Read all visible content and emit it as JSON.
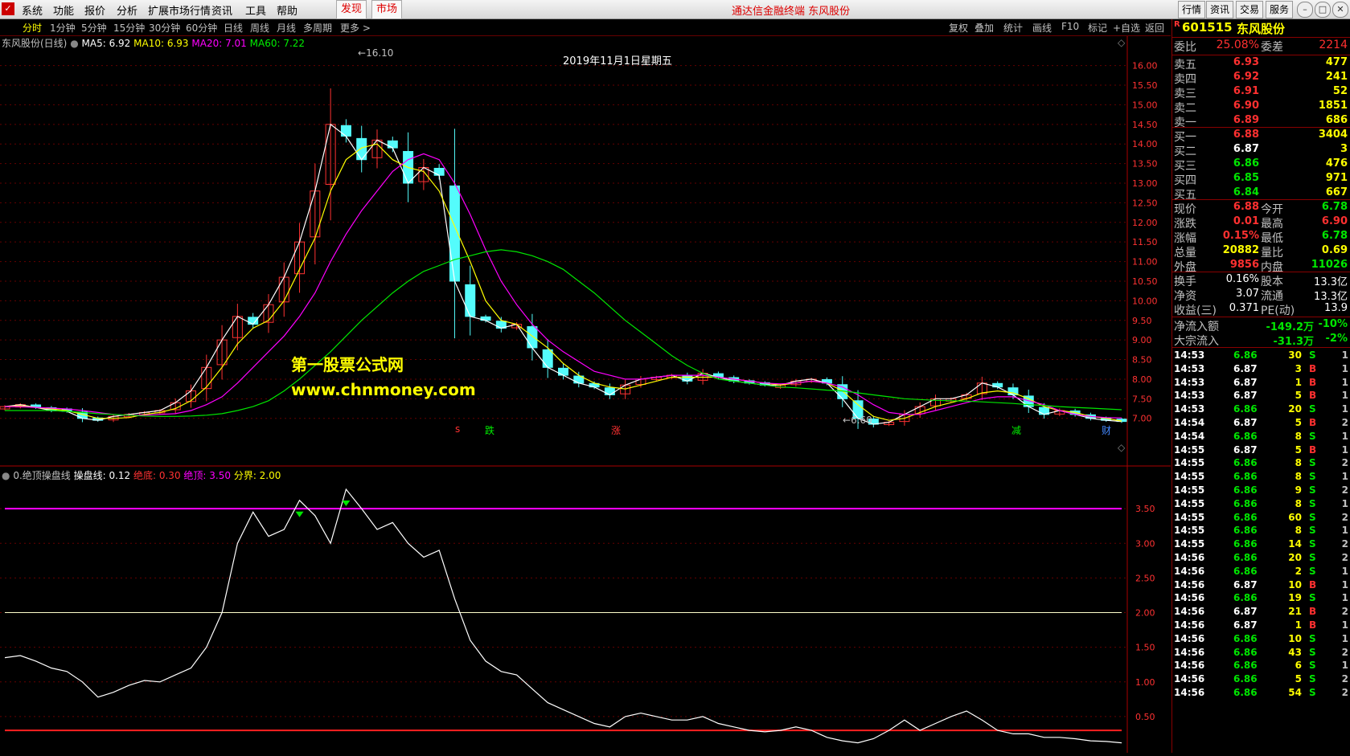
{
  "menu": {
    "items": [
      "系统",
      "功能",
      "报价",
      "分析",
      "扩展市场行情",
      "资讯",
      "工具",
      "帮助"
    ],
    "warn_btn": "发现",
    "market_btn": "市场",
    "app_title": "通达信金融终端  东风股份",
    "right_buttons": [
      "行情",
      "资讯",
      "交易",
      "服务"
    ]
  },
  "periods": [
    "分时",
    "1分钟",
    "5分钟",
    "15分钟",
    "30分钟",
    "60分钟",
    "日线",
    "周线",
    "月线",
    "多周期",
    "更多 >"
  ],
  "toolbar": [
    "复权",
    "叠加",
    "统计",
    "画线",
    "F10",
    "标记",
    "+自选",
    "返回"
  ],
  "main_legend": {
    "name": "东风股份(日线)",
    "ma5": "MA5: 6.92",
    "ma10": "MA10: 6.93",
    "ma20": "MA20: 7.01",
    "ma60": "MA60: 7.22"
  },
  "date_label": "2019年11月1日星期五",
  "high_label": "16.10",
  "low_label": "6.60",
  "watermark": {
    "line1": "第一股票公式网",
    "line2": "www.chnmoney.com"
  },
  "event_marks": [
    "s",
    "跌",
    "涨",
    "减",
    "财"
  ],
  "sub_legend": {
    "name": "0.绝顶操盘线",
    "line": "操盘线: 0.12",
    "bottom": "绝底: 0.30",
    "top": "绝顶: 3.50",
    "divide": "分界: 2.00"
  },
  "price_axis": [
    "16.00",
    "15.50",
    "15.00",
    "14.50",
    "14.00",
    "13.50",
    "13.00",
    "12.50",
    "12.00",
    "11.50",
    "11.00",
    "10.50",
    "10.00",
    "9.50",
    "9.00",
    "8.50",
    "8.00",
    "7.50",
    "7.00"
  ],
  "sub_axis": [
    "3.50",
    "3.00",
    "2.50",
    "2.00",
    "1.50",
    "1.00",
    "0.50"
  ],
  "colors": {
    "up": "#ff3232",
    "down": "#54fcfc",
    "ma5": "#ffffff",
    "ma10": "#ffff00",
    "ma20": "#ff00ff",
    "ma60": "#00e600"
  },
  "quote": {
    "code": "601515",
    "name": "东风股份",
    "weibi_label": "委比",
    "weibi": "25.08%",
    "weicha_label": "委差",
    "weicha": "2214",
    "asks": [
      {
        "label": "卖五",
        "price": "6.93",
        "vol": "477"
      },
      {
        "label": "卖四",
        "price": "6.92",
        "vol": "241"
      },
      {
        "label": "卖三",
        "price": "6.91",
        "vol": "52"
      },
      {
        "label": "卖二",
        "price": "6.90",
        "vol": "1851"
      },
      {
        "label": "卖一",
        "price": "6.89",
        "vol": "686"
      }
    ],
    "bids": [
      {
        "label": "买一",
        "price": "6.88",
        "vol": "3404"
      },
      {
        "label": "买二",
        "price": "6.87",
        "vol": "3"
      },
      {
        "label": "买三",
        "price": "6.86",
        "vol": "476"
      },
      {
        "label": "买四",
        "price": "6.85",
        "vol": "971"
      },
      {
        "label": "买五",
        "price": "6.84",
        "vol": "667"
      }
    ],
    "stats1": [
      {
        "l1": "现价",
        "v1": "6.88",
        "c1": "red",
        "l2": "今开",
        "v2": "6.78",
        "c2": "green"
      },
      {
        "l1": "涨跌",
        "v1": "0.01",
        "c1": "red",
        "l2": "最高",
        "v2": "6.90",
        "c2": "red"
      },
      {
        "l1": "涨幅",
        "v1": "0.15%",
        "c1": "red",
        "l2": "最低",
        "v2": "6.78",
        "c2": "green"
      },
      {
        "l1": "总量",
        "v1": "20882",
        "c1": "yellow",
        "l2": "量比",
        "v2": "0.69",
        "c2": "yellow"
      },
      {
        "l1": "外盘",
        "v1": "9856",
        "c1": "red",
        "l2": "内盘",
        "v2": "11026",
        "c2": "green"
      }
    ],
    "stats2": [
      {
        "l1": "换手",
        "v1": "0.16%",
        "l2": "股本",
        "v2": "13.3亿"
      },
      {
        "l1": "净资",
        "v1": "3.07",
        "l2": "流通",
        "v2": "13.3亿"
      },
      {
        "l1": "收益(三)",
        "v1": "0.371",
        "l2": "PE(动)",
        "v2": "13.9"
      }
    ],
    "flow": [
      {
        "label": "净流入额",
        "value": "-149.2万",
        "pct": "-10%"
      },
      {
        "label": "大宗流入",
        "value": "-31.3万",
        "pct": "-2%"
      }
    ]
  },
  "ticks": [
    {
      "t": "14:53",
      "p": "6.86",
      "v": "30",
      "s": "S",
      "n": "1"
    },
    {
      "t": "14:53",
      "p": "6.87",
      "v": "3",
      "s": "B",
      "n": "1"
    },
    {
      "t": "14:53",
      "p": "6.87",
      "v": "1",
      "s": "B",
      "n": "1"
    },
    {
      "t": "14:53",
      "p": "6.87",
      "v": "5",
      "s": "B",
      "n": "1"
    },
    {
      "t": "14:53",
      "p": "6.86",
      "v": "20",
      "s": "S",
      "n": "1"
    },
    {
      "t": "14:54",
      "p": "6.87",
      "v": "5",
      "s": "B",
      "n": "2"
    },
    {
      "t": "14:54",
      "p": "6.86",
      "v": "8",
      "s": "S",
      "n": "1"
    },
    {
      "t": "14:55",
      "p": "6.87",
      "v": "5",
      "s": "B",
      "n": "1"
    },
    {
      "t": "14:55",
      "p": "6.86",
      "v": "8",
      "s": "S",
      "n": "2"
    },
    {
      "t": "14:55",
      "p": "6.86",
      "v": "8",
      "s": "S",
      "n": "1"
    },
    {
      "t": "14:55",
      "p": "6.86",
      "v": "9",
      "s": "S",
      "n": "2"
    },
    {
      "t": "14:55",
      "p": "6.86",
      "v": "8",
      "s": "S",
      "n": "1"
    },
    {
      "t": "14:55",
      "p": "6.86",
      "v": "60",
      "s": "S",
      "n": "2"
    },
    {
      "t": "14:55",
      "p": "6.86",
      "v": "8",
      "s": "S",
      "n": "1"
    },
    {
      "t": "14:55",
      "p": "6.86",
      "v": "14",
      "s": "S",
      "n": "2"
    },
    {
      "t": "14:56",
      "p": "6.86",
      "v": "20",
      "s": "S",
      "n": "2"
    },
    {
      "t": "14:56",
      "p": "6.86",
      "v": "2",
      "s": "S",
      "n": "1"
    },
    {
      "t": "14:56",
      "p": "6.87",
      "v": "10",
      "s": "B",
      "n": "1"
    },
    {
      "t": "14:56",
      "p": "6.86",
      "v": "19",
      "s": "S",
      "n": "1"
    },
    {
      "t": "14:56",
      "p": "6.87",
      "v": "21",
      "s": "B",
      "n": "2"
    },
    {
      "t": "14:56",
      "p": "6.87",
      "v": "1",
      "s": "B",
      "n": "1"
    },
    {
      "t": "14:56",
      "p": "6.86",
      "v": "10",
      "s": "S",
      "n": "1"
    },
    {
      "t": "14:56",
      "p": "6.86",
      "v": "43",
      "s": "S",
      "n": "2"
    },
    {
      "t": "14:56",
      "p": "6.86",
      "v": "6",
      "s": "S",
      "n": "1"
    },
    {
      "t": "14:56",
      "p": "6.86",
      "v": "5",
      "s": "S",
      "n": "2"
    },
    {
      "t": "14:56",
      "p": "6.86",
      "v": "54",
      "s": "S",
      "n": "2"
    }
  ],
  "chart_data": [
    {
      "type": "candlestick",
      "ylim": [
        6.4,
        16.3
      ],
      "series": [
        {
          "name": "MA5",
          "values": [
            7.3,
            7.35,
            7.28,
            7.2,
            7.18,
            7.0,
            6.95,
            7.05,
            7.1,
            7.15,
            7.2,
            7.4,
            7.7,
            8.3,
            9.0,
            9.6,
            9.4,
            9.9,
            10.6,
            11.5,
            12.8,
            14.5,
            14.2,
            13.6,
            14.1,
            13.9,
            13.0,
            13.4,
            13.2,
            10.5,
            9.6,
            9.5,
            9.3,
            9.4,
            8.8,
            8.3,
            8.1,
            7.9,
            7.8,
            7.6,
            7.85,
            8.0,
            8.05,
            8.1,
            7.95,
            8.15,
            8.05,
            7.95,
            7.9,
            7.85,
            7.85,
            7.95,
            8.0,
            7.9,
            7.5,
            7.0,
            6.85,
            6.9,
            7.1,
            7.3,
            7.5,
            7.5,
            7.6,
            7.9,
            7.8,
            7.6,
            7.3,
            7.1,
            7.2,
            7.1,
            7.0,
            6.95,
            6.92
          ]
        },
        {
          "name": "MA10",
          "values": [
            7.3,
            7.32,
            7.28,
            7.24,
            7.2,
            7.1,
            7.0,
            7.0,
            7.02,
            7.1,
            7.15,
            7.25,
            7.45,
            7.8,
            8.3,
            8.9,
            9.3,
            9.5,
            10.0,
            10.8,
            11.6,
            12.8,
            13.6,
            13.9,
            14.0,
            13.6,
            13.4,
            13.3,
            12.8,
            11.9,
            11.0,
            10.0,
            9.5,
            9.4,
            9.1,
            8.8,
            8.4,
            8.1,
            7.9,
            7.8,
            7.75,
            7.85,
            7.95,
            8.05,
            8.05,
            8.05,
            8.05,
            8.0,
            7.95,
            7.9,
            7.85,
            7.9,
            7.95,
            7.9,
            7.7,
            7.35,
            7.05,
            6.95,
            7.0,
            7.15,
            7.3,
            7.4,
            7.5,
            7.65,
            7.7,
            7.65,
            7.5,
            7.3,
            7.2,
            7.15,
            7.05,
            7.0,
            6.93
          ]
        },
        {
          "name": "MA20",
          "values": [
            7.3,
            7.3,
            7.28,
            7.26,
            7.24,
            7.2,
            7.15,
            7.1,
            7.08,
            7.08,
            7.1,
            7.12,
            7.2,
            7.35,
            7.55,
            7.9,
            8.3,
            8.7,
            9.1,
            9.6,
            10.2,
            11.0,
            11.7,
            12.3,
            12.8,
            13.3,
            13.6,
            13.75,
            13.6,
            13.0,
            12.2,
            11.3,
            10.5,
            9.9,
            9.4,
            9.0,
            8.7,
            8.45,
            8.2,
            8.1,
            8.0,
            8.0,
            8.05,
            8.1,
            8.1,
            8.1,
            8.05,
            8.0,
            7.95,
            7.9,
            7.88,
            7.9,
            7.95,
            7.9,
            7.8,
            7.6,
            7.35,
            7.15,
            7.1,
            7.1,
            7.2,
            7.3,
            7.4,
            7.5,
            7.55,
            7.55,
            7.45,
            7.35,
            7.2,
            7.1,
            7.05,
            7.02,
            7.01
          ]
        },
        {
          "name": "MA60",
          "values": [
            7.2,
            7.2,
            7.2,
            7.2,
            7.18,
            7.15,
            7.12,
            7.1,
            7.08,
            7.06,
            7.05,
            7.05,
            7.06,
            7.08,
            7.12,
            7.2,
            7.3,
            7.45,
            7.7,
            8.0,
            8.35,
            8.7,
            9.1,
            9.5,
            9.85,
            10.2,
            10.5,
            10.75,
            10.9,
            11.05,
            11.15,
            11.25,
            11.3,
            11.25,
            11.15,
            11.0,
            10.8,
            10.5,
            10.2,
            9.85,
            9.5,
            9.2,
            8.9,
            8.6,
            8.35,
            8.15,
            8.0,
            7.95,
            7.9,
            7.85,
            7.8,
            7.78,
            7.75,
            7.72,
            7.7,
            7.65,
            7.6,
            7.55,
            7.5,
            7.48,
            7.46,
            7.45,
            7.44,
            7.42,
            7.4,
            7.38,
            7.35,
            7.33,
            7.3,
            7.28,
            7.26,
            7.24,
            7.22
          ]
        }
      ]
    },
    {
      "type": "line",
      "ylim": [
        0,
        4.0
      ],
      "series": [
        {
          "name": "操盘线",
          "values": [
            1.35,
            1.38,
            1.3,
            1.2,
            1.15,
            1.0,
            0.78,
            0.85,
            0.95,
            1.02,
            1.0,
            1.1,
            1.2,
            1.5,
            2.0,
            3.0,
            3.45,
            3.1,
            3.2,
            3.62,
            3.4,
            3.0,
            3.78,
            3.5,
            3.2,
            3.3,
            3.0,
            2.8,
            2.9,
            2.2,
            1.6,
            1.3,
            1.15,
            1.1,
            0.9,
            0.7,
            0.6,
            0.5,
            0.4,
            0.35,
            0.5,
            0.55,
            0.5,
            0.45,
            0.45,
            0.5,
            0.4,
            0.35,
            0.3,
            0.28,
            0.3,
            0.35,
            0.3,
            0.2,
            0.15,
            0.12,
            0.18,
            0.3,
            0.45,
            0.3,
            0.4,
            0.5,
            0.58,
            0.45,
            0.3,
            0.25,
            0.25,
            0.2,
            0.2,
            0.18,
            0.15,
            0.14,
            0.12
          ]
        }
      ],
      "hlines": [
        {
          "name": "绝顶",
          "value": 3.5
        },
        {
          "name": "分界",
          "value": 2.0
        },
        {
          "name": "绝底",
          "value": 0.3
        }
      ]
    }
  ]
}
